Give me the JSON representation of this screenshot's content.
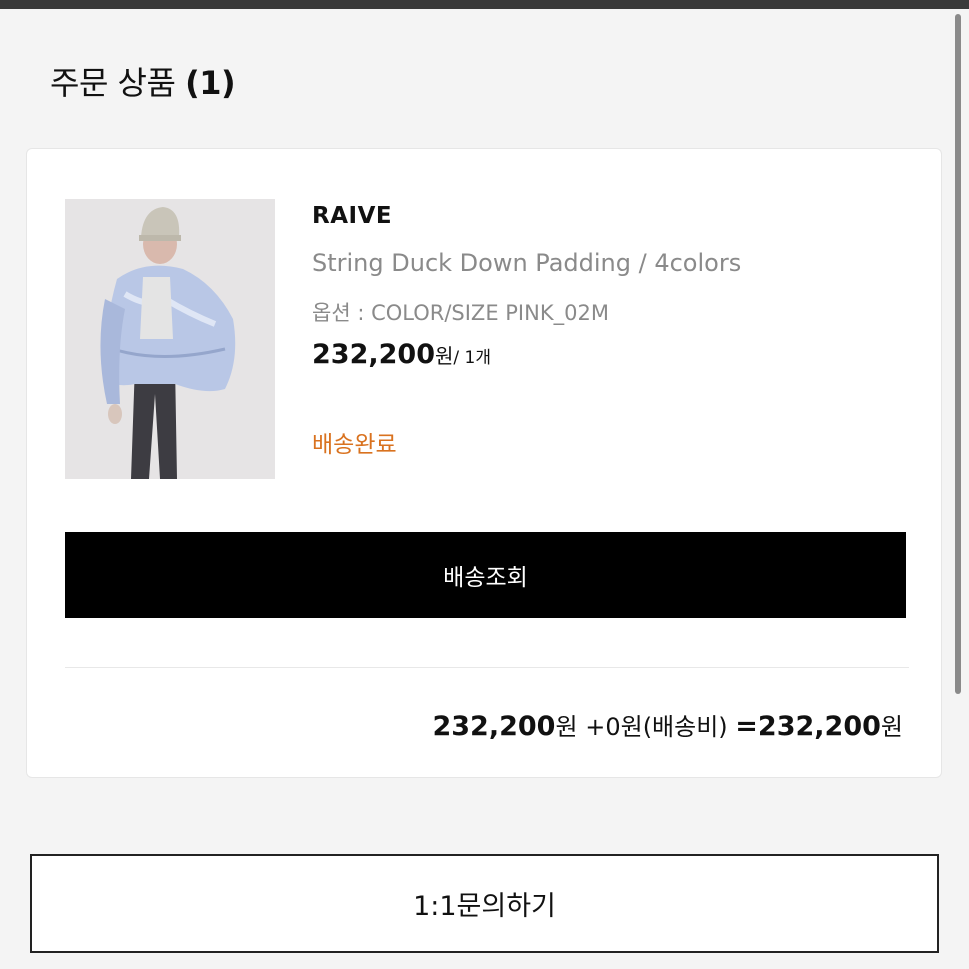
{
  "section": {
    "title": "주문 상품",
    "count": "(1)"
  },
  "order": {
    "brand": "RAIVE",
    "product_name": "String Duck Down Padding / 4colors",
    "option": "옵션 : COLOR/SIZE PINK_02M",
    "price": "232,200",
    "price_unit": "원",
    "quantity": "/ 1개",
    "status": "배송완료",
    "track_button": "배송조회"
  },
  "summary": {
    "product_total": "232,200",
    "won1": "원",
    "plus": "+0",
    "won2": "원",
    "shipping_label": "(배송비)",
    "equals": "=232,200",
    "won3": "원"
  },
  "inquiry_button": "1:1문의하기",
  "colors": {
    "status": "#d9721f",
    "button_dark": "#000000"
  }
}
